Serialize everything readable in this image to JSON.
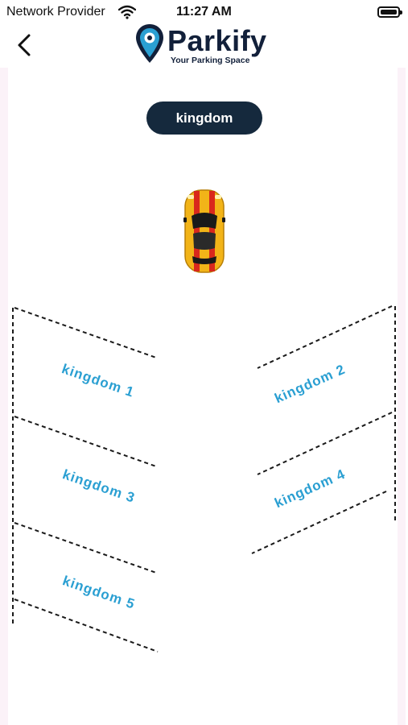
{
  "status_bar": {
    "carrier": "Network Provider",
    "time": "11:27 AM",
    "icons": [
      "wifi-icon",
      "battery-icon"
    ]
  },
  "header": {
    "back_icon": "chevron-left-icon",
    "brand": "Parkify",
    "tagline": "Your Parking Space",
    "logo_icon": "location-pin-icon"
  },
  "floor": {
    "label": "kingdom"
  },
  "car": {
    "icon": "car-icon",
    "body_color": "#f2b418",
    "stripe_color": "#d9281c"
  },
  "slots": [
    {
      "label": "kingdom 1"
    },
    {
      "label": "kingdom 2"
    },
    {
      "label": "kingdom 3"
    },
    {
      "label": "kingdom 4"
    },
    {
      "label": "kingdom 5"
    }
  ],
  "colors": {
    "brand_navy": "#12203a",
    "chip_bg": "#15293d",
    "slot_label": "#2a9fd2",
    "line": "#1a1a1a"
  }
}
